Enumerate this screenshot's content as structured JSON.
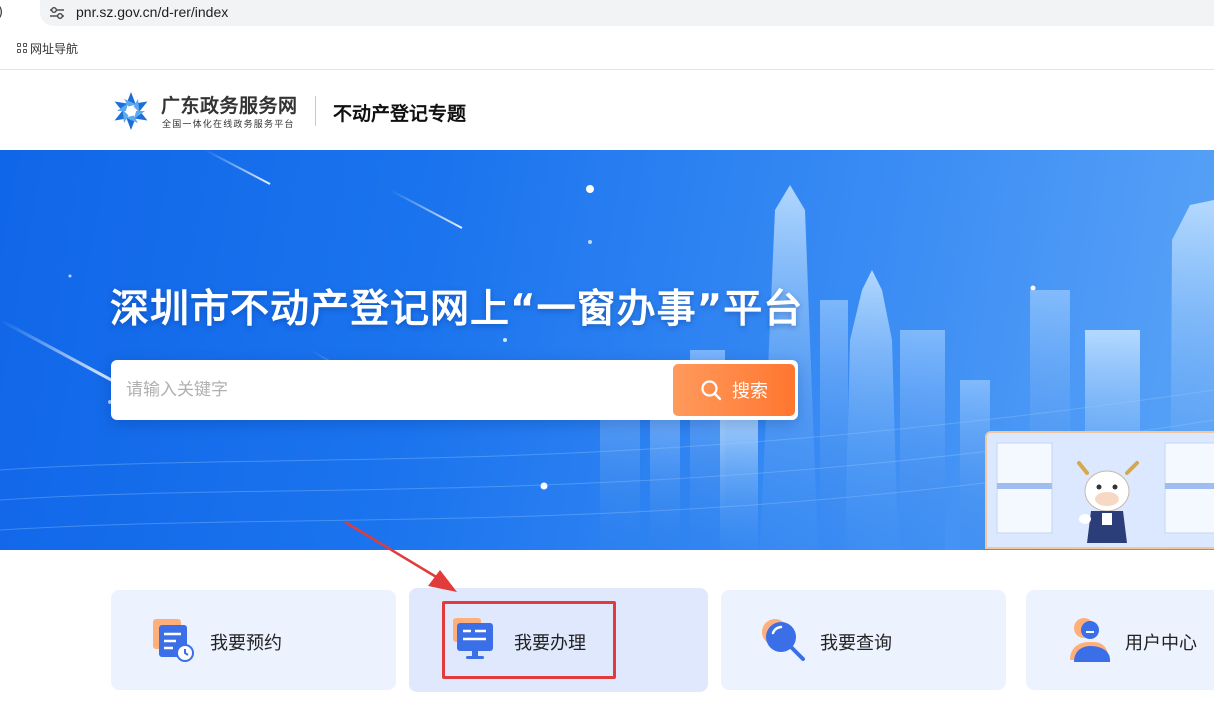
{
  "browser": {
    "url": "pnr.sz.gov.cn/d-rer/index",
    "bookmark_label": "网址导航"
  },
  "header": {
    "brand_name": "广东政务服务网",
    "brand_subtitle": "全国一体化在线政务服务平台",
    "topic_title": "不动产登记专题"
  },
  "hero": {
    "title": "深圳市不动产登记网上“一窗办事”平台",
    "search_placeholder": "请输入关键字",
    "search_button": "搜索"
  },
  "services": [
    {
      "label": "我要预约",
      "icon": "calendar-clock-icon"
    },
    {
      "label": "我要办理",
      "icon": "monitor-form-icon"
    },
    {
      "label": "我要查询",
      "icon": "magnifier-icon"
    },
    {
      "label": "用户中心",
      "icon": "user-icon"
    }
  ],
  "annotation": {
    "color": "#e23b3b"
  }
}
